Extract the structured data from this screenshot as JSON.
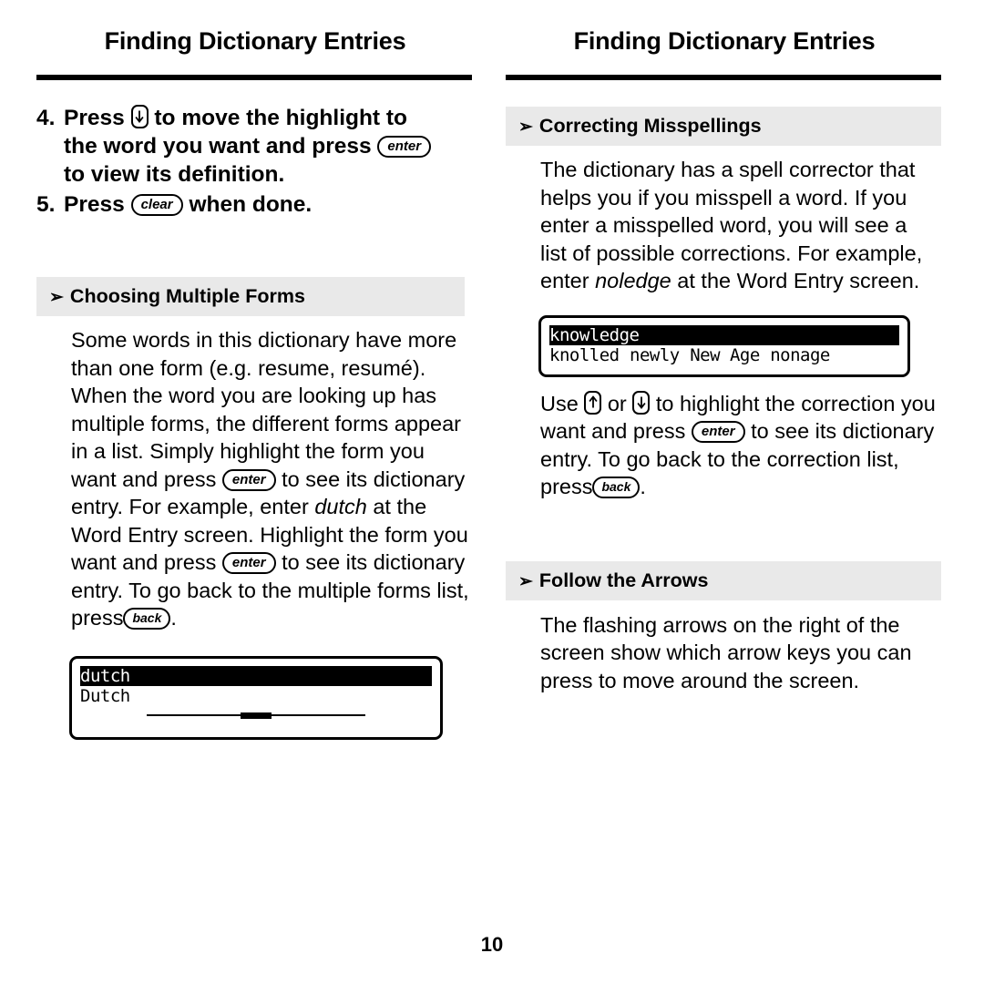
{
  "page": {
    "number": "10"
  },
  "left": {
    "header": "Finding Dictionary Entries",
    "steps": [
      {
        "num": "4.",
        "t1": "Press",
        "key1": "down-arrow",
        "t2": "to move the highlight to",
        "t3": "the word you want and press",
        "key2": "enter",
        "t4": "to view its definition."
      },
      {
        "num": "5.",
        "t1": "Press",
        "key1": "clear",
        "t2": "when done."
      }
    ],
    "section": {
      "chevron": "➢",
      "title": "Choosing Multiple Forms",
      "p1": "Some words in this dictionary have more than one form (e.g. resume, resumé). When the word you are looking up has multiple forms, the different forms appear in a list. Simply highlight the form you want and press",
      "key_enter_1": "enter",
      "p2": "to see its dictionary entry. For example, enter",
      "italic1": "dutch",
      "p3": "at the Word Entry screen. Highlight the form you want and press",
      "key_enter_2": "enter",
      "p4": "to see its dictionary entry. To go back to the multiple forms list, press",
      "key_back": "back",
      "p5": "."
    },
    "lcd": {
      "line1": "dutch",
      "line2": "Dutch"
    }
  },
  "right": {
    "header": "Finding Dictionary Entries",
    "section1": {
      "chevron": "➢",
      "title": "Correcting Misspellings",
      "p1": "The dictionary has a spell corrector that helps you if you misspell a word. If you enter a misspelled word, you will see a list of possible corrections. For example, enter",
      "italic1": "noledge",
      "p2": "at the Word Entry screen."
    },
    "lcd": {
      "line1": "knowledge",
      "line2": "knolled",
      "line3": "newly",
      "line4": "New Age",
      "line5": "nonage"
    },
    "after_lcd": {
      "t1": "Use",
      "key_up": "up-arrow",
      "t2": "or",
      "key_down": "down-arrow",
      "t3": "to highlight the correction you want and press",
      "key_enter": "enter",
      "t4": "to see its dictionary entry. To go back to the correction list, press",
      "key_back": "back",
      "t5": "."
    },
    "section2": {
      "chevron": "➢",
      "title": "Follow the Arrows",
      "p1": "The flashing arrows on the right of the screen show which arrow keys you can press to move around the screen."
    }
  }
}
